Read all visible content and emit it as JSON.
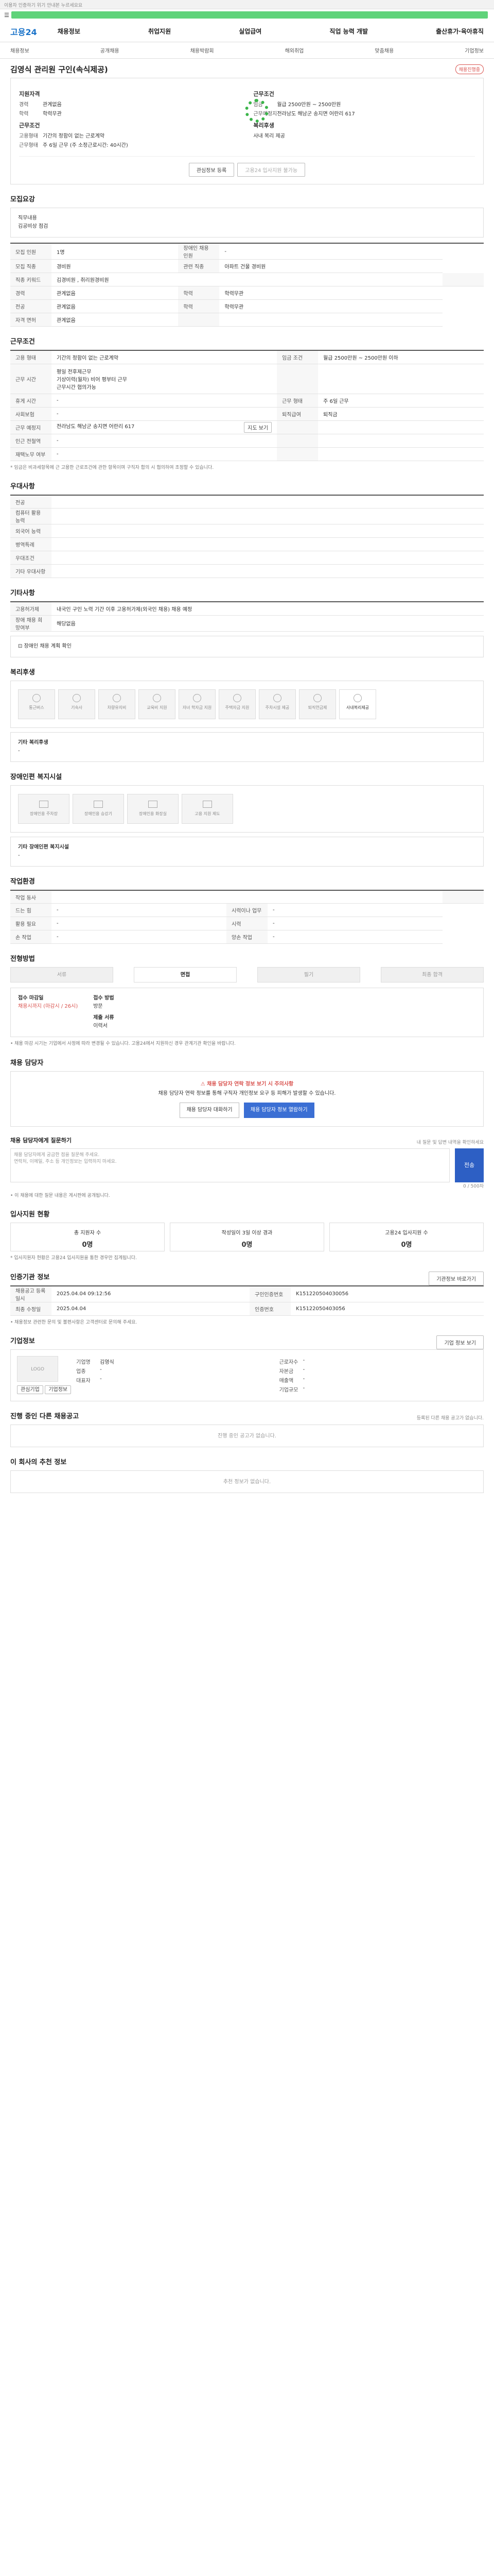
{
  "topbar": {
    "notice": "이용자 인증하기 위기 안내본 누르세요요"
  },
  "header": {
    "logo": "고용24",
    "menu": [
      "채용정보",
      "취업지원",
      "실업급여",
      "직업 능력 개발",
      "출산휴가·육아휴직"
    ],
    "utils": "로그인 회원가입"
  },
  "lnb": [
    "채용정보",
    "공개채용",
    "채용박람회",
    "해외취업",
    "맞춤채용",
    "기업정보"
  ],
  "job": {
    "title": "김영식 관리원 구인(속식제공)",
    "status": "채용진행중",
    "company_label": "지원자격",
    "career_label": "경력",
    "career": "관계없음",
    "edu_label": "학력",
    "edu": "학력무관",
    "cond_label": "근무조건",
    "emp_label": "고용형태",
    "emp": "기간의 정함이 없는 근로계약",
    "hours_label": "근무형태",
    "hours": "주 6일 근무 (주 소정근로시간: 40시간)",
    "summary_label": "근무조건",
    "pay_label": "임금",
    "pay": "월급 2500만원 ~ 2500만원",
    "place_label": "근무예정지",
    "place": "전라남도 해남군 송지면 어란리 617",
    "benefit_label": "복리후생",
    "benefit": "사내 복리 제공"
  },
  "buttons": {
    "interest": "관심정보 등록",
    "apply": "고용24 입사지원 불가능"
  },
  "recruit": {
    "title": "모집요강",
    "duty_label": "직무내용",
    "duty": "김공비상 점검",
    "rows": [
      [
        "모집 인원",
        "1명",
        "장애인 채용 인원",
        "-"
      ],
      [
        "모집 직종",
        "경비원",
        "관련 직종",
        "아파트 건물 경비원"
      ],
      [
        "직종 키워드",
        "김경비원 , 취리원경비원",
        ""
      ],
      [
        "경력",
        "관계없음",
        "학력",
        "학력무관"
      ],
      [
        "전공",
        "관계없음",
        "학력",
        "학력무관"
      ],
      [
        "자격 면허",
        "관계없음",
        "",
        ""
      ]
    ]
  },
  "work": {
    "title": "근무조건",
    "rows": [
      [
        "고용 형태",
        "기간의 정함이 없는 근로계약",
        "임금 조건",
        "월급 2500만원 ~ 2500만원 이하"
      ],
      [
        "근무 시간",
        "주 소정근로시간 40시간",
        "",
        ""
      ],
      [
        "휴게 시간",
        "-",
        "근무 형태",
        "주 6일 근무"
      ],
      [
        "사회보험",
        "-",
        "퇴직급여",
        "퇴직금"
      ],
      [
        "근무 예정지",
        "전라남도 해남군 송지면 어란리 617",
        "",
        ""
      ],
      [
        "인근 전철역",
        "-",
        "",
        ""
      ],
      [
        "재택노무 여부",
        "-",
        "",
        ""
      ]
    ],
    "shift": "평일 전후제근무\n기상이력(월차) 비어 평부터 근무\n근무시간 협의가능",
    "map_button": "지도 보기",
    "note": "* 임금은 비과세항목에 근 고용한 근로조건에 관한 항목이며 구직자 합의 시 협의하여 조정할 수 있습니다."
  },
  "prefer": {
    "title": "우대사항",
    "rows": [
      [
        "전공",
        ""
      ],
      [
        "컴퓨터 활용 능력",
        ""
      ],
      [
        "외국어 능력",
        ""
      ],
      [
        "병역특례",
        ""
      ],
      [
        "우대조건",
        ""
      ],
      [
        "기타 우대사항",
        ""
      ]
    ]
  },
  "etc": {
    "title": "기타사항",
    "rows": [
      [
        "고용허가제",
        "내국인 구인 노력 기간 이후 고용허가제(외국인 채용) 채용 예정"
      ],
      [
        "장애 채용 희망여부",
        "해당없음"
      ]
    ],
    "link": "장애인 채용 계획 확인"
  },
  "welfare": {
    "title": "복리후생",
    "items": [
      "통근버스",
      "기숙사",
      "차량유지비",
      "교육비 지원",
      "자녀 학자금 지원",
      "주택자금 지원",
      "주차시설 제공",
      "퇴직연금제",
      "사내복리제공"
    ],
    "other_label": "기타 복리후생",
    "other": "-"
  },
  "disability": {
    "title": "장애인편 복지시설",
    "items": [
      "장애인용 주차장",
      "장애인용 승강기",
      "장애인용 화장실",
      "고용 지원 제도"
    ],
    "other_label": "기타 장애인편 복지시설",
    "other": "-"
  },
  "env": {
    "title": "작업환경",
    "rows": [
      [
        "작업 동사",
        "",
        ""
      ],
      [
        "드는 힘",
        "-",
        "시력이나 업무",
        "-"
      ],
      [
        "활용 필요",
        "-",
        "시력",
        "-"
      ],
      [
        "손 작업",
        "-",
        "양손 작업",
        "-"
      ]
    ]
  },
  "process": {
    "title": "전형방법",
    "tabs": [
      "서류",
      "면접",
      "필기",
      "최종 합격"
    ],
    "label1": "접수 마감일",
    "value1": "채용시까지 (마감시 / 26시)",
    "label2": "접수 방법",
    "value2": "방문",
    "label3": "제출 서류",
    "value3": "이력서",
    "notes": "• 채용 마감 시기는 기업에서 사정에 따라 변경될 수 있습니다. 고용24에서 지원하신 경우 관계기관 확인을 바랍니다."
  },
  "contact": {
    "title": "채용 담당자",
    "alert": "채용 담당자 연락 정보 보기 시 주의사항",
    "alert_text": "채용 담당자 연락 정보를 통해 구직자 개인정보 요구 등 피해가 발생할 수 있습니다.",
    "btn1": "채용 담당자 대화하기",
    "btn2": "채용 담당자 정보 열람하기"
  },
  "question": {
    "title": "채용 담당자에게 질문하기",
    "hint": "내 질문 및 답변 내역을 확인하세요",
    "placeholder": "채용 담당자에게 궁금한 점을 질문해 주세요.\n연락처, 이메일, 주소 등 개인정보는 입력하지 마세요.",
    "counter": "0 / 500자",
    "send": "전송",
    "notes": "• 이 채용에 대한 질문 내용은 게시판에 공개됩니다."
  },
  "apply_stats": {
    "title": "입사지원 현황",
    "items": [
      [
        "총 지원자 수",
        "0명"
      ],
      [
        "작성일이 3일 이상 경과",
        "0명"
      ],
      [
        "고용24 입사지원 수",
        "0명"
      ]
    ],
    "note": "* 입사지원자 현황은 고용24 입사지원을 통한 경우만 집계됩니다."
  },
  "reg": {
    "title": "인증기관 정보",
    "btn": "기관정보 바로가기",
    "rows": [
      [
        "채용공고 등록일시",
        "2025.04.04 09:12:56",
        "구인인증번호",
        "K151220504030056"
      ],
      [
        "최종 수정일",
        "2025.04.04",
        "인증번호",
        "K15122050403056"
      ]
    ],
    "notes": "• 채용정보 관련한 문의 및 불편사항은 고객센터로 문의해 주세요."
  },
  "company": {
    "title": "기업정보",
    "btn": "기업 정보 보기",
    "logo": "LOGO",
    "rows": [
      [
        "기업명",
        "김영식"
      ],
      [
        "업종",
        "-"
      ],
      [
        "대표자",
        "-"
      ]
    ],
    "rows2": [
      [
        "근로자수",
        "-"
      ],
      [
        "자본금",
        "-"
      ],
      [
        "매출액",
        "-"
      ],
      [
        "기업규모",
        "-"
      ]
    ],
    "fav": "관심기업",
    "more": "기업정보"
  },
  "other_jobs": {
    "title": "진행 중인 다른 채용공고",
    "hint": "등록된 다른 채용 공고가 없습니다.",
    "empty": "진행 중인 공고가 없습니다."
  },
  "recommend": {
    "title": "이 회사의 추천 정보",
    "empty": "추천 정보가 없습니다."
  }
}
